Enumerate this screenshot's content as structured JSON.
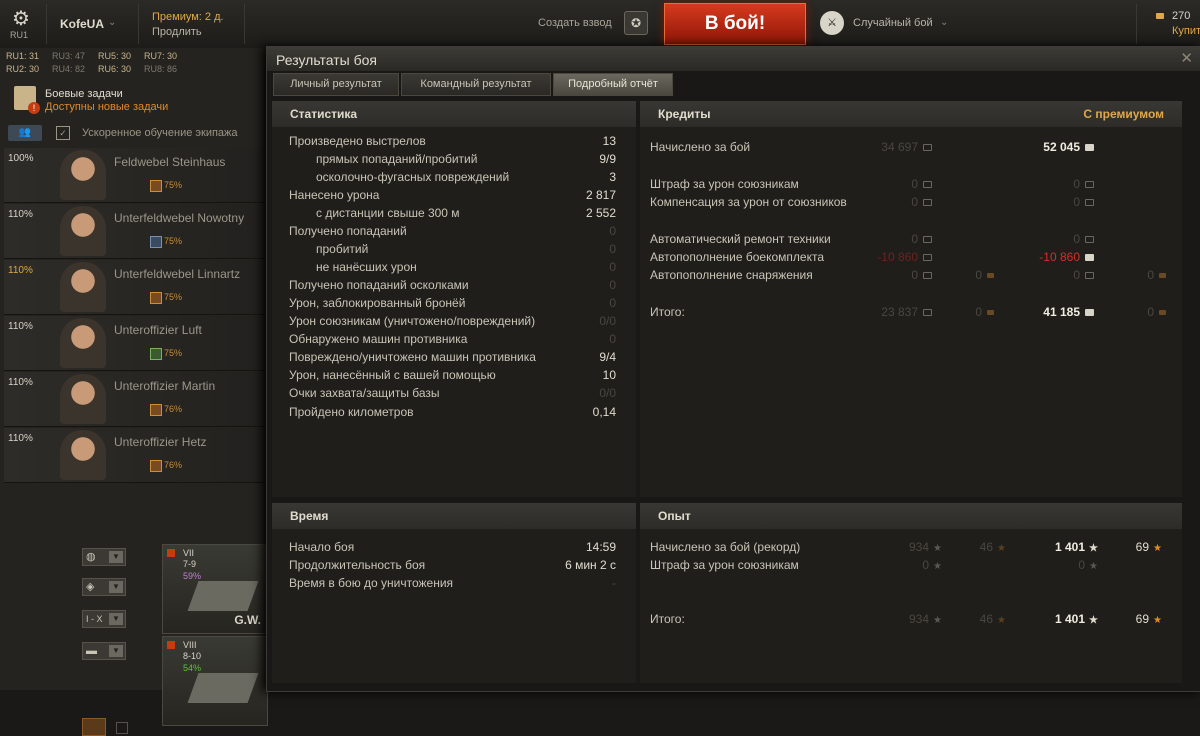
{
  "topbar": {
    "server": "RU1",
    "username": "KofeUA",
    "premium": "Премиум: 2 д.",
    "extend": "Продлить",
    "platoon": "Создать взвод",
    "battle_button": "В бой!",
    "battle_mode": "Случайный бой",
    "gold": "270",
    "buy": "Купить"
  },
  "left": {
    "ru_stats": [
      "RU1: 31",
      "RU3: 47",
      "RU5: 30",
      "RU7: 30",
      "RU2: 30",
      "RU4: 82",
      "RU6: 30",
      "RU8: 86"
    ],
    "tasks_title": "Боевые задачи",
    "tasks_sub": "Доступны новые задачи",
    "tasks_badge": "!",
    "crew_training": "Ускоренное обучение экипажа",
    "crew": [
      {
        "pct": "100%",
        "name": "Feldwebel Steinhaus",
        "skill": "75%"
      },
      {
        "pct": "110%",
        "name": "Unterfeldwebel Nowotny",
        "skill": "75%"
      },
      {
        "pct": "110%",
        "name": "Unterfeldwebel Linnartz",
        "skill": "75%"
      },
      {
        "pct": "110%",
        "name": "Unteroffizier Luft",
        "skill": "75%"
      },
      {
        "pct": "110%",
        "name": "Unteroffizier Martin",
        "skill": "76%"
      },
      {
        "pct": "110%",
        "name": "Unteroffizier Hetz",
        "skill": "76%"
      }
    ],
    "filter_level": "I - X",
    "vehicles": [
      {
        "tier": "VII",
        "level": "7-9",
        "pct": "59%",
        "name": "G.W."
      },
      {
        "tier": "VIII",
        "level": "8-10",
        "pct": "54%",
        "name": ""
      }
    ]
  },
  "window": {
    "title": "Результаты боя",
    "tabs": [
      "Личный результат",
      "Командный результат",
      "Подробный отчёт"
    ],
    "stats": {
      "title": "Статистика",
      "rows": [
        {
          "label": "Произведено выстрелов",
          "value": "13",
          "indent": false,
          "dim": false
        },
        {
          "label": "прямых попаданий/пробитий",
          "value": "9/9",
          "indent": true,
          "dim": false
        },
        {
          "label": "осколочно-фугасных повреждений",
          "value": "3",
          "indent": true,
          "dim": false
        },
        {
          "label": "Нанесено урона",
          "value": "2 817",
          "indent": false,
          "dim": false
        },
        {
          "label": "с дистанции свыше 300 м",
          "value": "2 552",
          "indent": true,
          "dim": false
        },
        {
          "label": "Получено попаданий",
          "value": "0",
          "indent": false,
          "dim": true
        },
        {
          "label": "пробитий",
          "value": "0",
          "indent": true,
          "dim": true
        },
        {
          "label": "не нанёсших урон",
          "value": "0",
          "indent": true,
          "dim": true
        },
        {
          "label": "Получено попаданий осколками",
          "value": "0",
          "indent": false,
          "dim": true
        },
        {
          "label": "Урон, заблокированный бронёй",
          "value": "0",
          "indent": false,
          "dim": true
        },
        {
          "label": "Урон союзникам (уничтожено/повреждений)",
          "value": "0/0",
          "indent": false,
          "dim": true
        },
        {
          "label": "Обнаружено машин противника",
          "value": "0",
          "indent": false,
          "dim": true
        },
        {
          "label": "Повреждено/уничтожено машин противника",
          "value": "9/4",
          "indent": false,
          "dim": false
        },
        {
          "label": "Урон, нанесённый с вашей помощью",
          "value": "10",
          "indent": false,
          "dim": false
        },
        {
          "label": "Очки захвата/защиты базы",
          "value": "0/0",
          "indent": false,
          "dim": true
        },
        {
          "label": "Пройдено километров",
          "value": "0,14",
          "indent": false,
          "dim": false
        }
      ]
    },
    "credits": {
      "title": "Кредиты",
      "premium_title": "С премиумом",
      "rows": [
        {
          "label": "Начислено за бой",
          "base": "34 697",
          "base_gold": "",
          "prem": "52 045",
          "prem_gold": ""
        },
        {
          "label": "Штраф за урон союзникам",
          "base": "0",
          "base_gold": "",
          "prem": "0",
          "prem_gold": ""
        },
        {
          "label": "Компенсация за урон от союзников",
          "base": "0",
          "base_gold": "",
          "prem": "0",
          "prem_gold": ""
        },
        {
          "label": "Автоматический ремонт техники",
          "base": "0",
          "base_gold": "",
          "prem": "0",
          "prem_gold": ""
        },
        {
          "label": "Автопополнение боекомплекта",
          "base": "-10 860",
          "base_gold": "",
          "prem": "-10 860",
          "prem_gold": ""
        },
        {
          "label": "Автопополнение снаряжения",
          "base": "0",
          "base_gold": "0",
          "prem": "0",
          "prem_gold": "0"
        },
        {
          "label": "Итого:",
          "base": "23 837",
          "base_gold": "0",
          "prem": "41 185",
          "prem_gold": "0"
        }
      ]
    },
    "time": {
      "title": "Время",
      "rows": [
        {
          "label": "Начало боя",
          "value": "14:59"
        },
        {
          "label": "Продолжительность боя",
          "value": "6 мин 2 с"
        },
        {
          "label": "Время в бою до уничтожения",
          "value": "-"
        }
      ]
    },
    "exp": {
      "title": "Опыт",
      "rows": [
        {
          "label": "Начислено за бой (рекорд)",
          "base": "934",
          "base_free": "46",
          "prem": "1 401",
          "prem_free": "69"
        },
        {
          "label": "Штраф за урон союзникам",
          "base": "0",
          "base_free": "",
          "prem": "0",
          "prem_free": ""
        },
        {
          "label": "Итого:",
          "base": "934",
          "base_free": "46",
          "prem": "1 401",
          "prem_free": "69"
        }
      ]
    }
  }
}
